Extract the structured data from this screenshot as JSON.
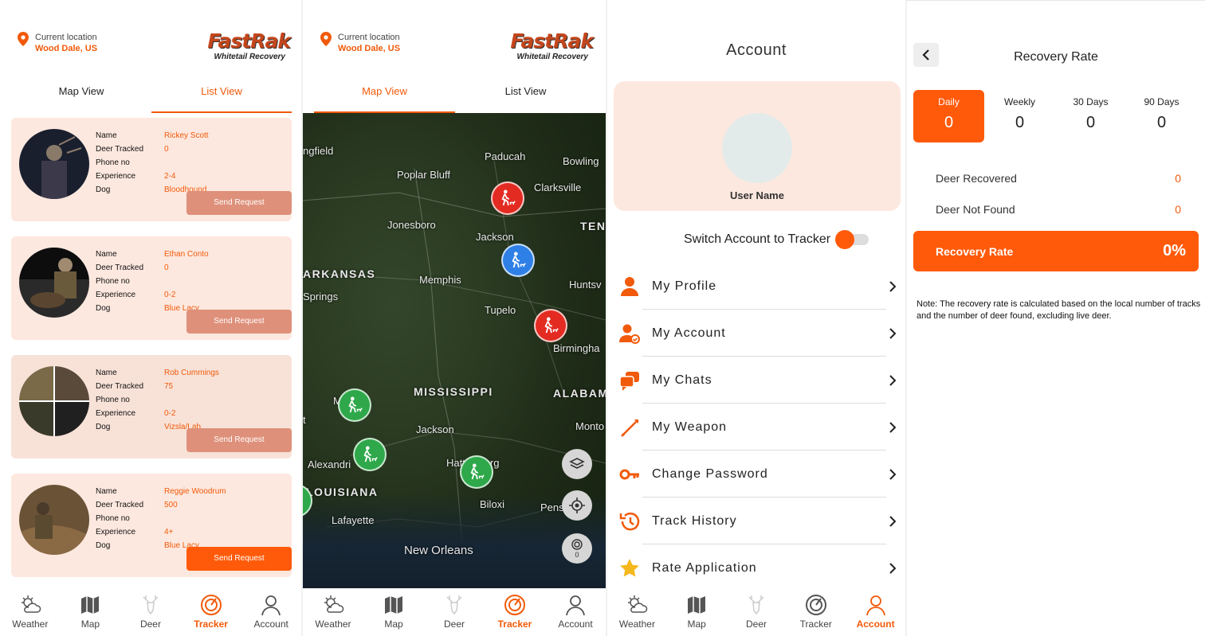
{
  "colors": {
    "accent": "#ff5a0a",
    "card_bg": "#fde8df",
    "request_disabled": "#de907a"
  },
  "header": {
    "location_label": "Current location",
    "location_value": "Wood Dale, US",
    "logo_line1": "FastRak",
    "logo_line2": "Whitetail Recovery"
  },
  "tabs": {
    "map_view": "Map View",
    "list_view": "List View"
  },
  "trackers": [
    {
      "name_label": "Name",
      "name": "Rickey Scott",
      "tracked_label": "Deer Tracked",
      "tracked": "0",
      "phone_label": "Phone no",
      "phone": "",
      "exp_label": "Experience",
      "exp": "2-4",
      "dog_label": "Dog",
      "dog": "Bloodhound",
      "button": "Send Request",
      "button_active": false
    },
    {
      "name_label": "Name",
      "name": "Ethan Conto",
      "tracked_label": "Deer Tracked",
      "tracked": "0",
      "phone_label": "Phone no",
      "phone": "",
      "exp_label": "Experience",
      "exp": "0-2",
      "dog_label": "Dog",
      "dog": "Blue Lacy",
      "button": "Send Request",
      "button_active": false
    },
    {
      "name_label": "Name",
      "name": "Rob Cummings",
      "tracked_label": "Deer Tracked",
      "tracked": "75",
      "phone_label": "Phone no",
      "phone": "",
      "exp_label": "Experience",
      "exp": "0-2",
      "dog_label": "Dog",
      "dog": "Vizsla/Lab",
      "button": "Send Request",
      "button_active": false
    },
    {
      "name_label": "Name",
      "name": "Reggie Woodrum",
      "tracked_label": "Deer Tracked",
      "tracked": "500",
      "phone_label": "Phone no",
      "phone": "",
      "exp_label": "Experience",
      "exp": "4+",
      "dog_label": "Dog",
      "dog": "Blue Lacy",
      "button": "Send Request",
      "button_active": true
    }
  ],
  "nav": {
    "weather": "Weather",
    "map": "Map",
    "deer": "Deer",
    "tracker": "Tracker",
    "account": "Account"
  },
  "map": {
    "labels": {
      "springfield": "ngfield",
      "paducah": "Paducah",
      "bowling": "Bowling",
      "poplar": "Poplar Bluff",
      "clarksville": "Clarksville",
      "jonesboro": "Jonesboro",
      "jackson_tn": "Jackson",
      "ten": "TEN",
      "arkansas": "ARKANSAS",
      "memphis": "Memphis",
      "huntsville": "Huntsv",
      "springs": "Springs",
      "tupelo": "Tupelo",
      "birmingham": "Birmingha",
      "mississippi": "MISSISSIPPI",
      "alabama": "ALABAM",
      "m": "M",
      "t": "t",
      "jackson_ms": "Jackson",
      "montgomery": "Monto",
      "alexandria": "Alexandri",
      "hattiesburg": "Hattiesburg",
      "louisiana": "LOUISIANA",
      "biloxi": "Biloxi",
      "pensacola": "Pens",
      "lafayette": "Lafayette",
      "new_orleans": "New Orleans"
    },
    "radar_count": "0"
  },
  "account": {
    "title": "Account",
    "user_name": "User Name",
    "switch_label": "Switch Account to Tracker",
    "menu": [
      "My Profile",
      "My Account",
      "My Chats",
      "My Weapon",
      "Change Password",
      "Track History",
      "Rate Application"
    ]
  },
  "recovery": {
    "title": "Recovery Rate",
    "periods": [
      {
        "label": "Daily",
        "value": "0"
      },
      {
        "label": "Weekly",
        "value": "0"
      },
      {
        "label": "30 Days",
        "value": "0"
      },
      {
        "label": "90 Days",
        "value": "0"
      }
    ],
    "recovered_label": "Deer Recovered",
    "recovered_value": "0",
    "not_found_label": "Deer Not Found",
    "not_found_value": "0",
    "rate_label": "Recovery Rate",
    "rate_value": "0%",
    "note": "Note: The recovery rate is calculated based on the local number of tracks and the number of deer found, excluding live deer."
  }
}
